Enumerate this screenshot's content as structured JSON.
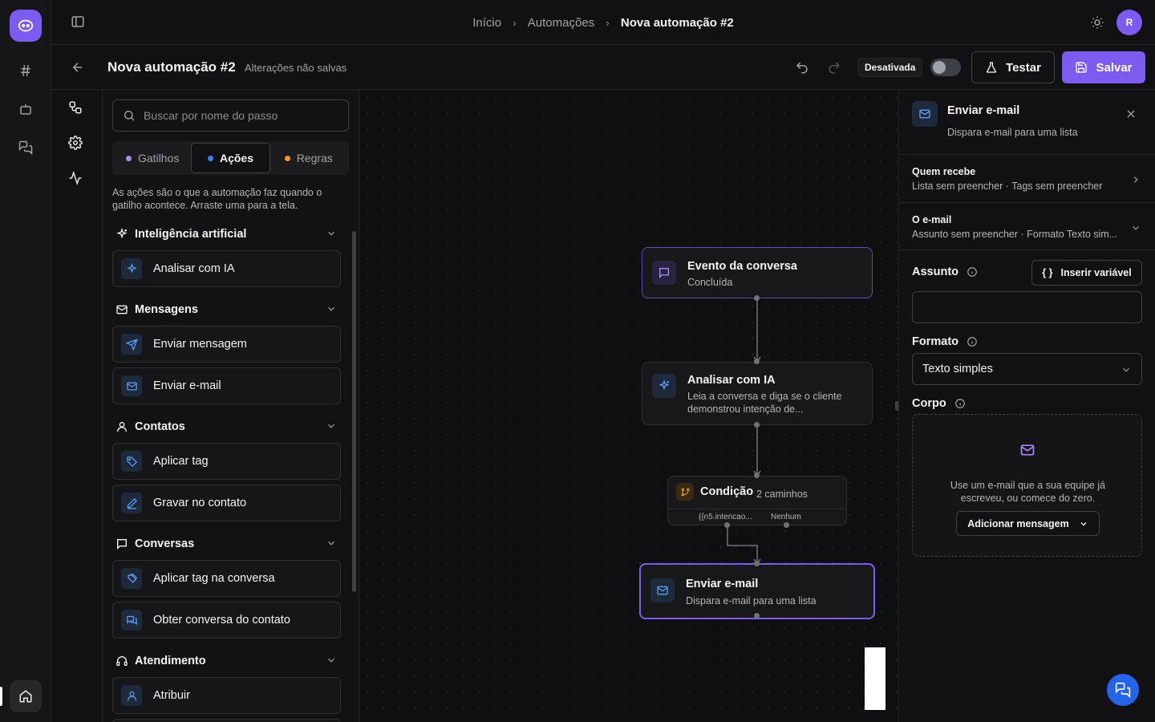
{
  "topbar": {
    "breadcrumbs": [
      "Início",
      "Automações",
      "Nova automação #2"
    ],
    "avatar_initial": "R"
  },
  "editor": {
    "title": "Nova automação #2",
    "unsaved": "Alterações não salvas",
    "status": "Desativada",
    "status_enabled": false,
    "test_label": "Testar",
    "save_label": "Salvar"
  },
  "palette": {
    "search_placeholder": "Buscar por nome do passo",
    "tabs": [
      {
        "label": "Gatilhos",
        "color": "#a78bfa",
        "active": false
      },
      {
        "label": "Ações",
        "color": "#3b82f6",
        "active": true
      },
      {
        "label": "Regras",
        "color": "#f59e0b",
        "active": false
      }
    ],
    "description": "As ações são o que a automação faz quando o gatilho acontece. Arraste uma para a tela.",
    "categories": [
      {
        "label": "Inteligência artificial",
        "icon": "sparkles-icon",
        "items": [
          {
            "label": "Analisar com IA",
            "icon": "sparkles-icon"
          }
        ]
      },
      {
        "label": "Mensagens",
        "icon": "mail-icon",
        "items": [
          {
            "label": "Enviar mensagem",
            "icon": "send-icon"
          },
          {
            "label": "Enviar e-mail",
            "icon": "mail-icon"
          }
        ]
      },
      {
        "label": "Contatos",
        "icon": "user-icon",
        "items": [
          {
            "label": "Aplicar tag",
            "icon": "tag-icon"
          },
          {
            "label": "Gravar no contato",
            "icon": "pencil-icon"
          }
        ]
      },
      {
        "label": "Conversas",
        "icon": "chat-icon",
        "items": [
          {
            "label": "Aplicar tag na conversa",
            "icon": "tags-icon"
          },
          {
            "label": "Obter conversa do contato",
            "icon": "chats-icon"
          }
        ]
      },
      {
        "label": "Atendimento",
        "icon": "headset-icon",
        "items": [
          {
            "label": "Atribuir",
            "icon": "user-icon"
          }
        ]
      }
    ]
  },
  "flow": {
    "nodes": [
      {
        "title": "Evento da conversa",
        "subtitle": "Concluída",
        "icon": "chat-icon"
      },
      {
        "title": "Analisar com IA",
        "subtitle": "Leia a conversa e diga se o cliente demonstrou intenção de...",
        "icon": "sparkles-icon"
      },
      {
        "title": "Condição",
        "count": "2 caminhos",
        "branches": [
          "{{n5.intencao...",
          "Nenhum"
        ],
        "icon": "branch-icon"
      },
      {
        "title": "Enviar e-mail",
        "subtitle": "Dispara e-mail para uma lista",
        "icon": "mail-icon",
        "selected": true
      }
    ]
  },
  "inspector": {
    "title": "Enviar e-mail",
    "subtitle": "Dispara e-mail para uma lista",
    "sections": [
      {
        "title": "Quem recebe",
        "summary": "Lista sem preencher · Tags sem preencher"
      },
      {
        "title": "O e-mail",
        "summary": "Assunto sem preencher · Formato Texto sim..."
      }
    ],
    "subject_label": "Assunto",
    "insert_variable": "Inserir variável",
    "subject_value": "",
    "format_label": "Formato",
    "format_value": "Texto simples",
    "body_label": "Corpo",
    "body_hint": "Use um e-mail que a sua equipe já escreveu, ou comece do zero.",
    "add_message": "Adicionar mensagem"
  },
  "colors": {
    "accent": "#7c5cf0",
    "ai_icon": "#5b9cf5",
    "condition": "#f59e0b",
    "fab": "#2563eb"
  }
}
